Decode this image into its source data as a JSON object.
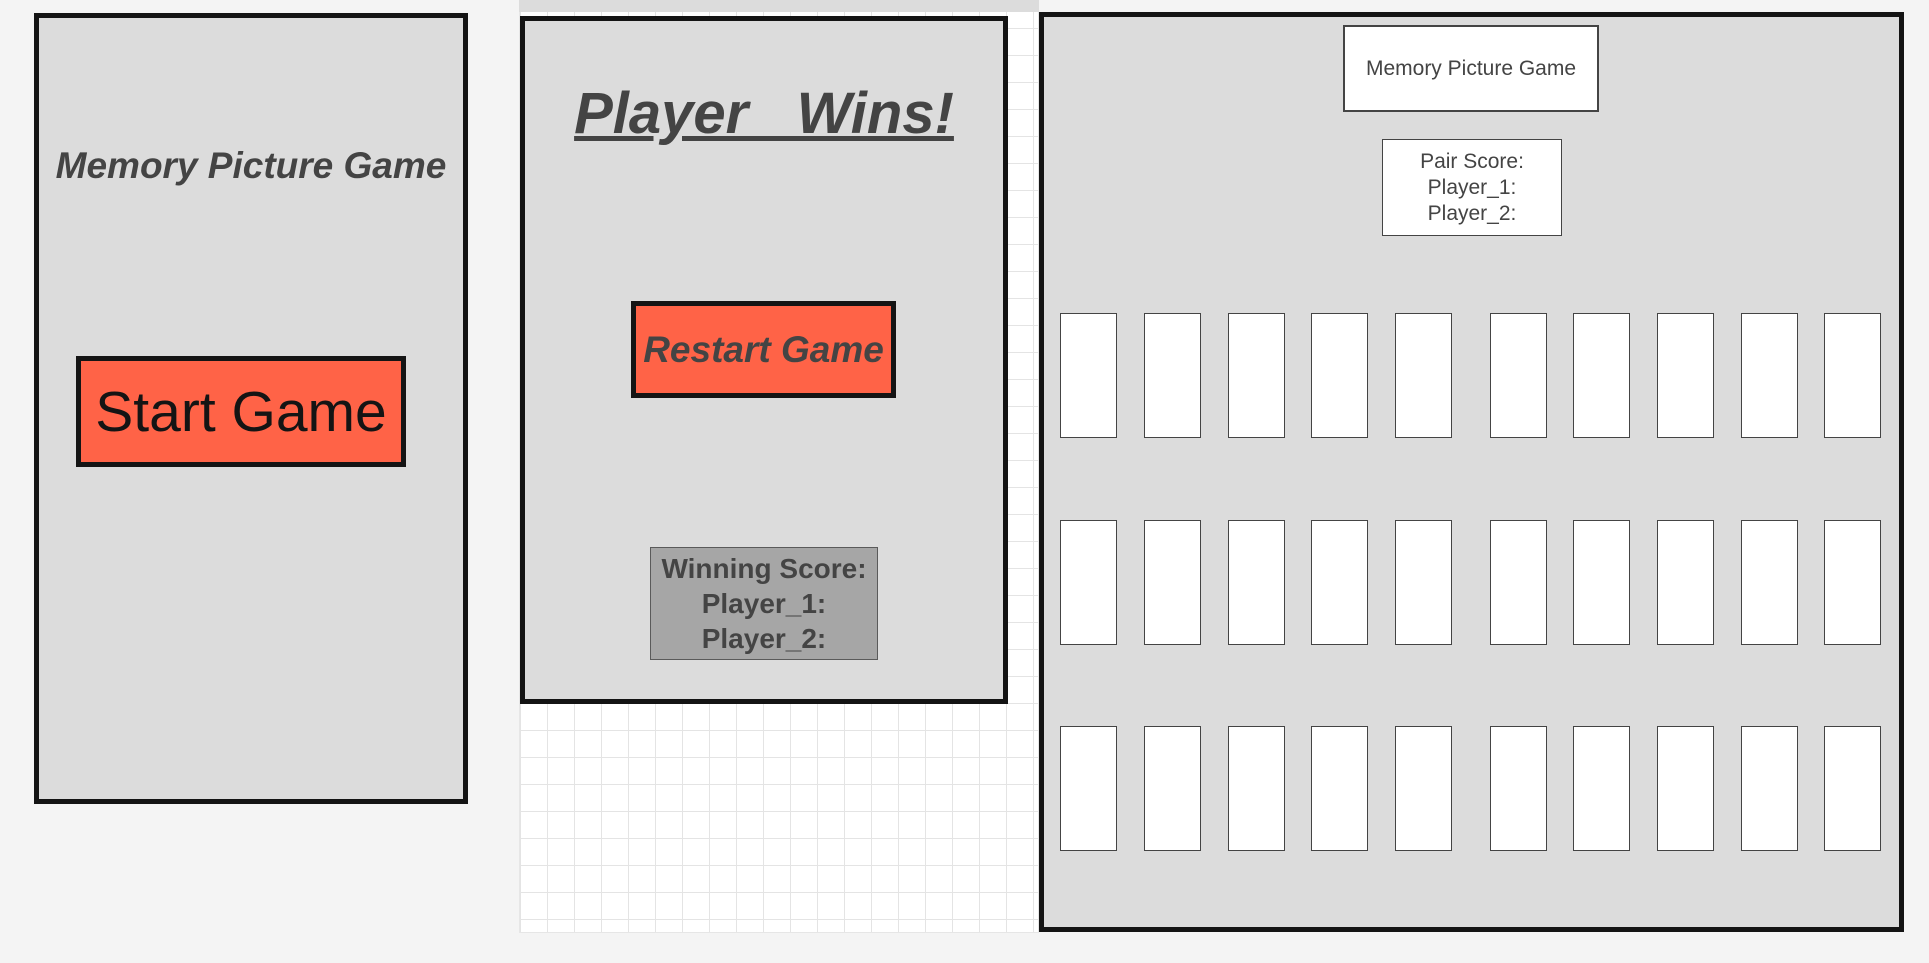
{
  "start_screen": {
    "title": "Memory Picture Game",
    "start_button": "Start Game"
  },
  "win_screen": {
    "title": "Player   Wins!",
    "restart_button": "Restart Game",
    "winning_score": {
      "label": "Winning Score:",
      "player_1": "Player_1:",
      "player_2": "Player_2:"
    }
  },
  "board_screen": {
    "title": "Memory Picture Game",
    "pair_score": {
      "label": "Pair Score:",
      "player_1": "Player_1:",
      "player_2": "Player_2:"
    },
    "card_rows": 3,
    "card_columns": 10
  },
  "colors": {
    "button_fill": "#ff6347",
    "panel_fill": "#dcdcdc",
    "winning_box_fill": "#a6a6a6",
    "text": "#444444"
  }
}
